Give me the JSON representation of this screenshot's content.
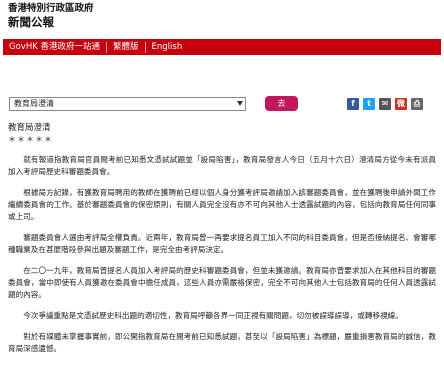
{
  "masthead": {
    "gov_name": "香港特別行政區政府",
    "publication": "新聞公報"
  },
  "nav": {
    "items": [
      "GovHK 香港政府一站通",
      "繁體版",
      "English"
    ]
  },
  "toolbar": {
    "dropdown_value": "教育局澄清",
    "go_label": "去",
    "share_icons": [
      {
        "name": "facebook-icon",
        "glyph": "f",
        "color": "#3b5998"
      },
      {
        "name": "twitter-icon",
        "glyph": "t",
        "color": "#1da1f2"
      },
      {
        "name": "email-icon",
        "glyph": "✉",
        "color": "#555555"
      },
      {
        "name": "weibo-icon",
        "glyph": "微",
        "color": "#d52b1e"
      },
      {
        "name": "print-icon",
        "glyph": "⎙",
        "color": "#666666"
      }
    ]
  },
  "article": {
    "headline": "教育局澄清",
    "stars": "＊＊＊＊＊",
    "paragraphs": [
      "就有報道指教育局官員閱考前已知悉文憑試試題並「設局陷害」，教育局發言人今日（五月十六日）澄清局方從今未有派員加入考評局歷史科審題委員會。",
      "根據局方記錄，有獲教育局聘用的教師在獲聘前已經以個人身分獲考評局邀請加入該審題委員會，並在獲聘後申請外間工作繼續委員會的工作。基於審題委員會的保密原則，有關人員完全沒有亦不可向其他人士透露試題的內容，包括向教育局任何同事或上司。",
      "審題委員會人選由考評局全權負責。近兩年，教育局曾一再要求提名員工加入不同的科目委員會，但是否接納提名、會審哪種職業及在甚麼階段參與出題及審題工作，是完全由考評局決定。",
      "在二〇一九年，教育局曾提名人員加入考評局的歷史科審題委員會，但並未獲邀請。教育局亦曾要求加入在其他科目的審題委員會，當中即使有人員獲邀在委員會中擔任成員，這些人員亦需嚴格保密，完全不可向其他人士包括教育局的任何人員透露試題的內容。",
      "今次爭議重點是文憑試歷史科出題的適切性，教育局呼籲各界一同正視有關問題，切勿被誤導誤導，或轉移視線。",
      "對於有媒體未掌握事實前，即公開指教育局在閱考前已知悉試題，甚至以「設局陷害」為標題，嚴重損害教育局的誠信，教育局深感遺憾。"
    ]
  }
}
